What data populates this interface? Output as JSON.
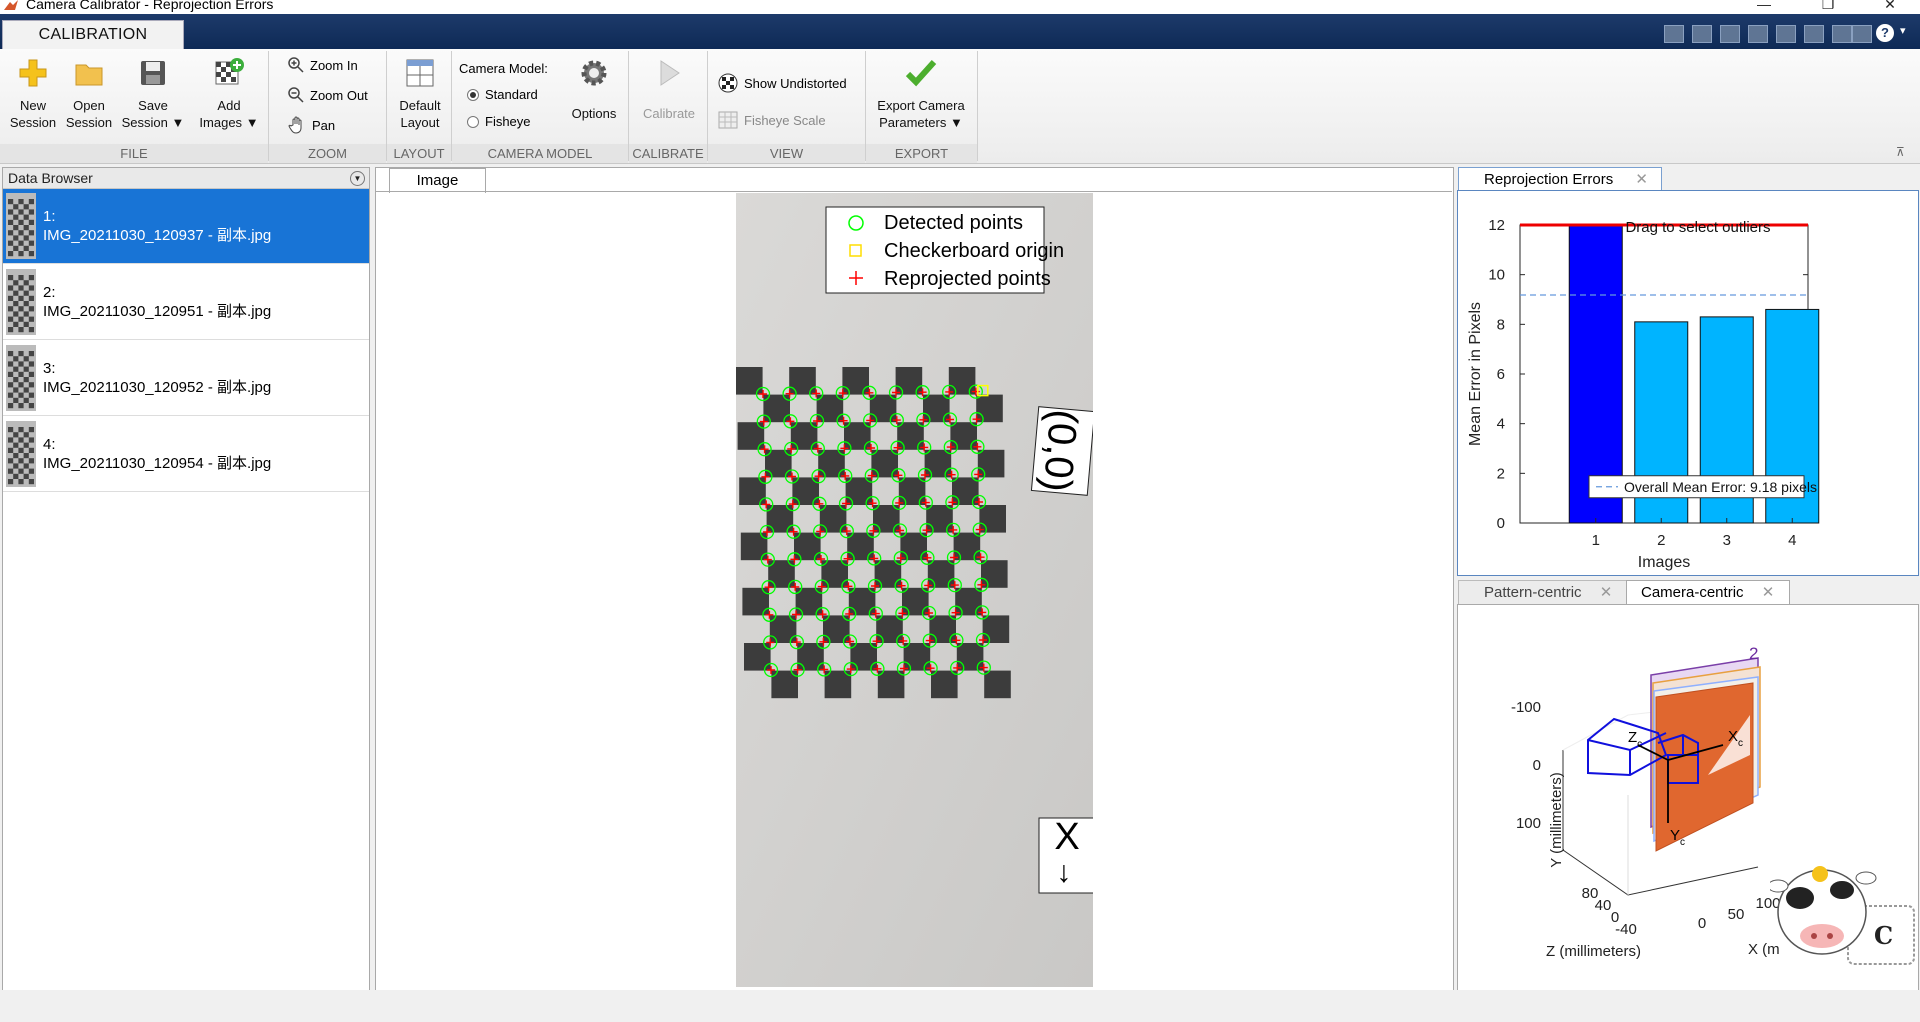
{
  "window": {
    "title": "Camera Calibrator - Reprojection Errors"
  },
  "ribbon": {
    "tab": "CALIBRATION",
    "file": {
      "section": "FILE",
      "new_session": [
        "New",
        "Session"
      ],
      "open_session": [
        "Open",
        "Session"
      ],
      "save_session": [
        "Save",
        "Session"
      ],
      "add_images": [
        "Add",
        "Images"
      ]
    },
    "zoom": {
      "section": "ZOOM",
      "zoom_in": "Zoom In",
      "zoom_out": "Zoom Out",
      "pan": "Pan"
    },
    "layout": {
      "section": "LAYOUT",
      "default_layout": [
        "Default",
        "Layout"
      ]
    },
    "camera_model": {
      "section": "CAMERA MODEL",
      "label": "Camera Model:",
      "standard": "Standard",
      "fisheye": "Fisheye",
      "selected": "Standard",
      "options": "Options"
    },
    "calibrate": {
      "section": "CALIBRATE",
      "calibrate": "Calibrate"
    },
    "view": {
      "section": "VIEW",
      "show_undistorted": "Show Undistorted",
      "fisheye_scale": "Fisheye Scale"
    },
    "export": {
      "section": "EXPORT",
      "export_params": [
        "Export Camera",
        "Parameters"
      ]
    }
  },
  "data_browser": {
    "title": "Data Browser",
    "items": [
      {
        "index": "1:",
        "name": "IMG_20211030_120937 - 副本.jpg",
        "selected": true
      },
      {
        "index": "2:",
        "name": "IMG_20211030_120951 - 副本.jpg",
        "selected": false
      },
      {
        "index": "3:",
        "name": "IMG_20211030_120952 - 副本.jpg",
        "selected": false
      },
      {
        "index": "4:",
        "name": "IMG_20211030_120954 - 副本.jpg",
        "selected": false
      }
    ]
  },
  "image_panel": {
    "tab": "Image",
    "legend": {
      "detected": "Detected points",
      "origin": "Checkerboard origin",
      "reprojected": "Reprojected points"
    },
    "origin_label": "(0,0)",
    "axis_label": "X",
    "axis_arrow": "→",
    "colors": {
      "detected": "#00ff00",
      "origin": "#ffff00",
      "reprojected": "#ff0000"
    }
  },
  "reprojection_panel": {
    "tab": "Reprojection Errors",
    "close": "✕",
    "chart_data": {
      "type": "bar",
      "categories": [
        "1",
        "2",
        "3",
        "4"
      ],
      "values": [
        12,
        8.1,
        8.3,
        8.6
      ],
      "selected_index": 0,
      "mean": 9.18,
      "ylim": [
        0,
        12
      ],
      "yticks": [
        "0",
        "2",
        "4",
        "6",
        "8",
        "10",
        "12"
      ],
      "xlabel": "Images",
      "ylabel": "Mean Error in Pixels",
      "annotation": "Drag to select outliers",
      "legend": "Overall Mean Error: 9.18 pixels",
      "colors": {
        "selected": "#0000ff",
        "bar": "#00b4ff",
        "threshold": "#ee0000",
        "mean": "#6699dd"
      }
    }
  },
  "extrinsics_panel": {
    "tab_pattern": "Pattern-centric",
    "tab_camera": "Camera-centric",
    "close": "✕",
    "y_label": "Y (millimeters)",
    "z_label": "Z (millimeters)",
    "x_label": "X (m",
    "y_ticks": [
      "-100",
      "0",
      "100"
    ],
    "z_ticks": [
      "80",
      "40",
      "0",
      "-40"
    ],
    "x_ticks": [
      "0",
      "50",
      "100"
    ],
    "axis_labels": {
      "xc": "X",
      "yc": "Y",
      "zc": "Z",
      "sub": "c"
    },
    "board_number": "2"
  }
}
